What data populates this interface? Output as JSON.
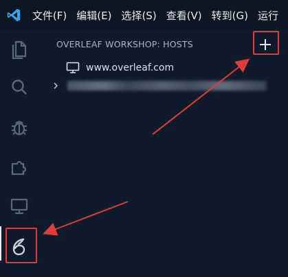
{
  "menubar": {
    "items": [
      "文件(F)",
      "编辑(E)",
      "选择(S)",
      "查看(V)",
      "转到(G)",
      "运行"
    ]
  },
  "activitybar": {
    "items": [
      "explorer-icon",
      "search-icon",
      "debug-icon",
      "extensions-icon",
      "remote-explorer-icon",
      "overleaf-icon"
    ],
    "active": "overleaf-icon"
  },
  "panel": {
    "title": "OVERLEAF WORKSHOP: HOSTS",
    "add_button_icon": "plus-icon",
    "hosts": [
      {
        "icon": "monitor-icon",
        "label": "www.overleaf.com"
      }
    ],
    "collapsed_item_icon": "chevron-right-icon"
  },
  "annotations": {
    "highlight_color": "#e03c3c"
  },
  "colors": {
    "background": "#0f1b2a",
    "menubar": "#0d1724",
    "vscode_blue": "#3aa3f0",
    "icon_gray": "#5b6a7b"
  }
}
